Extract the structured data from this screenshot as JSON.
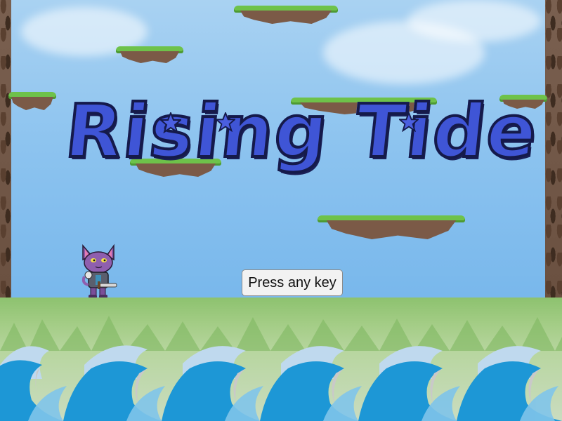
{
  "game": {
    "title": "Rising Tide",
    "prompt_button_label": "Press any key"
  },
  "colors": {
    "sky_top": "#a9d2f2",
    "sky_bottom": "#8cc6f0",
    "grass": "#6ec24a",
    "rock": "#7b5a47",
    "title_fill": "#3f55d6",
    "title_outline": "#151a4a",
    "wave_blue": "#1d97d6",
    "wave_light": "#7fc4ea",
    "ground": "#9cc97c"
  },
  "icons": {
    "player": "purple-cat-knight-icon",
    "title_star": "star-icon"
  }
}
